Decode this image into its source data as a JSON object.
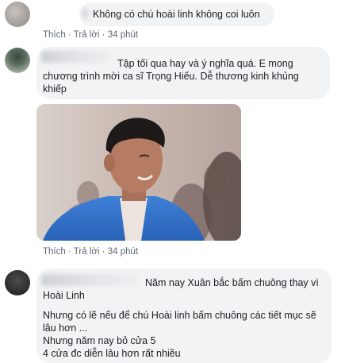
{
  "comments": [
    {
      "text": "Không có chú hoài linh không coi luôn",
      "actions": {
        "like": "Thích",
        "reply": "Trả lời",
        "time": "34 phút"
      }
    },
    {
      "text_line1": "Tập tối qua hay và ý nghĩa quá. E mong",
      "text_line2": "chương trình mời ca sĩ Trọng Hiếu. Dễ thương kinh khủng",
      "text_line3": "khiếp",
      "actions": {
        "like": "Thích",
        "reply": "Trả lời",
        "time": "34 phút"
      }
    },
    {
      "text_line1": "Năm nay Xuân bắc bấm chuông thay vì",
      "text_line2": "Hoài Linh",
      "text_line3": "Nhưng có lẽ nếu để chú Hoài linh bấm chuông các tiết mục sẽ",
      "text_line4": "lâu hơn ...",
      "text_line5": "Nhưng năm nay bỏ cửa 5",
      "text_line6": "4 cửa đc diễn lâu hơn rất nhiều"
    }
  ],
  "separator": "·"
}
